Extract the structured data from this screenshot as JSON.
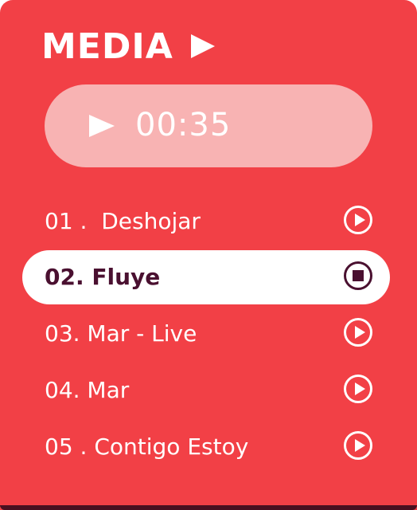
{
  "header": {
    "title": "MEDIA",
    "title_icon": "play-arrow-icon"
  },
  "player": {
    "icon": "play-icon",
    "time": "00:35"
  },
  "tracks": [
    {
      "label": "01 .  Deshojar",
      "state": "play",
      "icon": "play-circle-icon"
    },
    {
      "label": "02. Fluye",
      "state": "stop",
      "icon": "stop-circle-icon",
      "active": true
    },
    {
      "label": "03. Mar - Live",
      "state": "play",
      "icon": "play-circle-icon"
    },
    {
      "label": "04. Mar",
      "state": "play",
      "icon": "play-circle-icon"
    },
    {
      "label": "05 . Contigo Estoy",
      "state": "play",
      "icon": "play-circle-icon"
    }
  ],
  "colors": {
    "background": "#f24046",
    "pill": "#f8b3b3",
    "active_row": "#ffffff",
    "active_text": "#4a1030"
  }
}
